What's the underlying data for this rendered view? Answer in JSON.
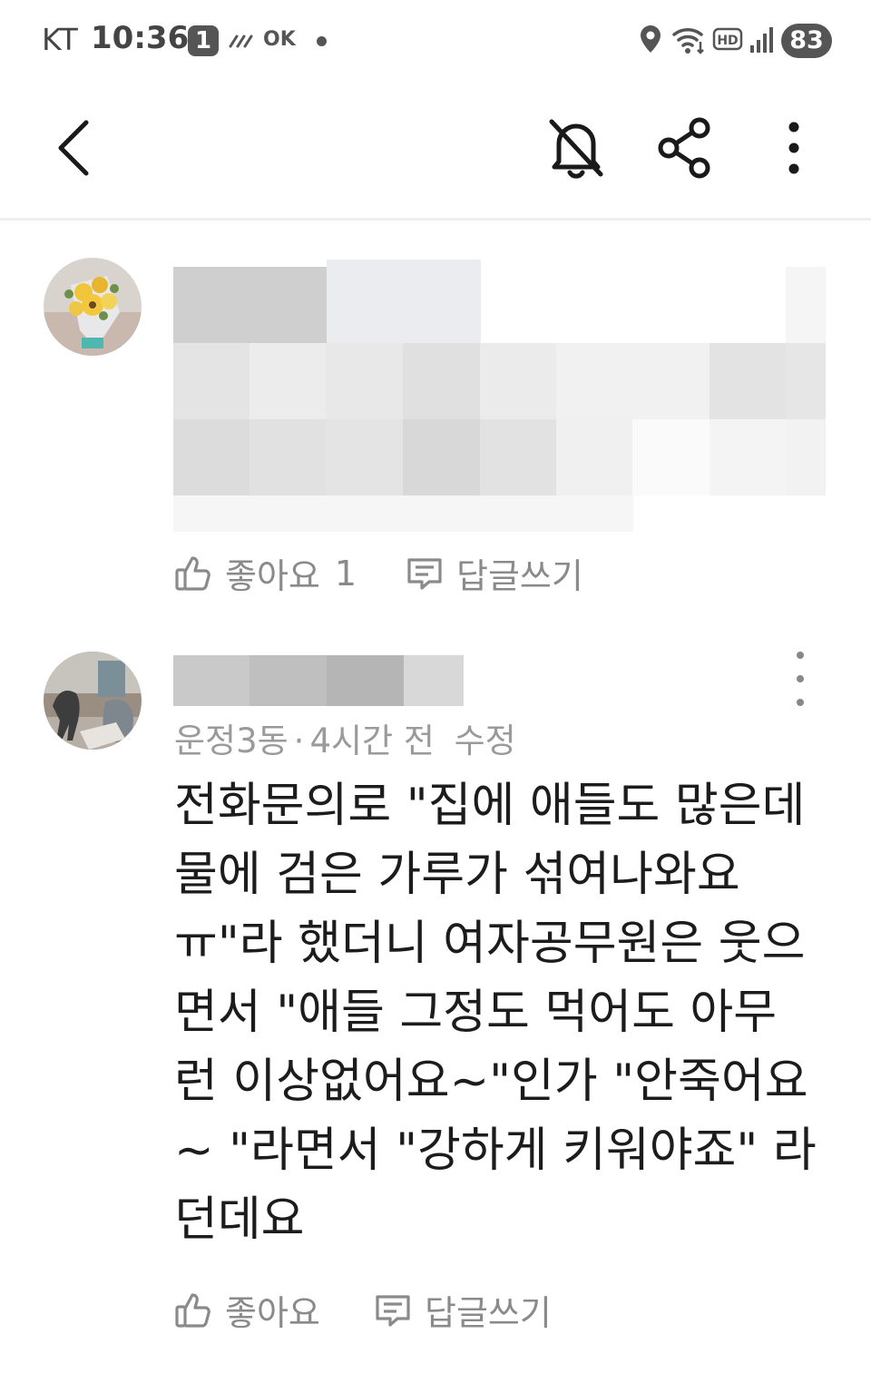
{
  "status_bar": {
    "carrier": "KT",
    "time": "10:36",
    "notification_badge": "1",
    "ok_glyph": "OK",
    "battery": "83",
    "icons": [
      "lines-icon",
      "ok-cashbag-icon",
      "dot-icon",
      "location-icon",
      "wifi-icon",
      "hd-voice-icon",
      "signal-icon",
      "battery-icon"
    ]
  },
  "app_bar": {
    "icons": [
      "back-arrow-icon",
      "bell-off-icon",
      "share-icon",
      "more-vertical-icon"
    ]
  },
  "comments": [
    {
      "author": "",
      "content_hidden": true,
      "like_label": "좋아요",
      "like_count": "1",
      "reply_label": "답글쓰기"
    },
    {
      "author": "",
      "location": "운정3동",
      "separator": "·",
      "time": "4시간 전",
      "edited": "수정",
      "body_lines": [
        "전화문의로 \"집에 애들도 많은데",
        "물에 검은 가루가 섞여나와요",
        "ㅠ\"라 했더니 여자공무원은 웃으",
        "면서 \"애들 그정도 먹어도 아무",
        "런 이상없어요~\"인가 \"안죽어요",
        "~ \"라면서 \"강하게 키워야죠\" 라",
        "던데요"
      ],
      "like_label": "좋아요",
      "reply_label": "답글쓰기"
    }
  ],
  "colors": {
    "text": "#1c1c1c",
    "muted": "#8a8a8a",
    "divider": "#eeeeee"
  }
}
